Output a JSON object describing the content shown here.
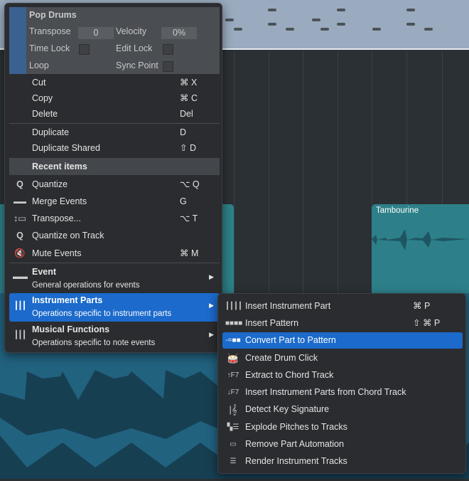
{
  "background": {
    "track_label": "Tambourine"
  },
  "colors": {
    "highlight": "#1c6acb",
    "teal": "#2d8089",
    "wave": "#21627f"
  },
  "context_menu": {
    "header": {
      "title": "Pop Drums",
      "transpose_label": "Transpose",
      "transpose_value": "0",
      "velocity_label": "Velocity",
      "velocity_value": "0%",
      "time_lock_label": "Time Lock",
      "edit_lock_label": "Edit Lock",
      "loop_label": "Loop",
      "sync_point_label": "Sync Point"
    },
    "edit_items": [
      {
        "label": "Cut",
        "shortcut": "⌘ X"
      },
      {
        "label": "Copy",
        "shortcut": "⌘ C"
      },
      {
        "label": "Delete",
        "shortcut": "Del"
      }
    ],
    "dup_items": [
      {
        "label": "Duplicate",
        "shortcut": "D"
      },
      {
        "label": "Duplicate Shared",
        "shortcut": "⇧ D"
      }
    ],
    "recent_header": "Recent items",
    "recent_items": [
      {
        "label": "Quantize",
        "shortcut": "⌥ Q",
        "icon": "quantize-icon"
      },
      {
        "label": "Merge Events",
        "shortcut": "G",
        "icon": "merge-icon"
      },
      {
        "label": "Transpose...",
        "shortcut": "⌥ T",
        "icon": "transpose-icon"
      },
      {
        "label": "Quantize on Track",
        "shortcut": "",
        "icon": "quantize-icon"
      },
      {
        "label": "Mute Events",
        "shortcut": "⌘ M",
        "icon": "mute-icon"
      }
    ],
    "groups": [
      {
        "title": "Event",
        "subtitle": "General operations for events"
      },
      {
        "title": "Instrument Parts",
        "subtitle": "Operations specific to instrument parts"
      },
      {
        "title": "Musical Functions",
        "subtitle": "Operations specific to note events"
      }
    ]
  },
  "submenu": {
    "items": [
      {
        "label": "Insert Instrument Part",
        "shortcut": "⌘ P"
      },
      {
        "label": "Insert Pattern",
        "shortcut": "⇧ ⌘ P"
      },
      {
        "label": "Convert Part to Pattern",
        "shortcut": ""
      },
      {
        "label": "Create Drum Click",
        "shortcut": ""
      },
      {
        "label": "Extract to Chord Track",
        "shortcut": ""
      },
      {
        "label": "Insert Instrument Parts from Chord Track",
        "shortcut": ""
      },
      {
        "label": "Detect Key Signature",
        "shortcut": ""
      },
      {
        "label": "Explode Pitches to Tracks",
        "shortcut": ""
      },
      {
        "label": "Remove Part Automation",
        "shortcut": ""
      },
      {
        "label": "Render Instrument Tracks",
        "shortcut": ""
      }
    ]
  }
}
